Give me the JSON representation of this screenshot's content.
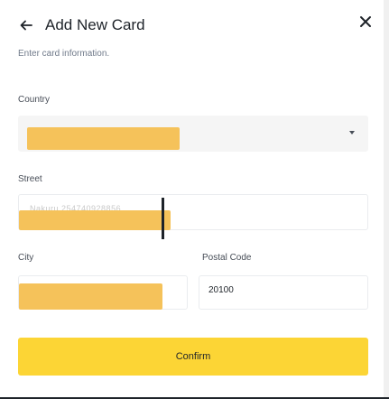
{
  "header": {
    "title": "Add New Card",
    "subtitle": "Enter card information."
  },
  "icons": {
    "back": "arrow-left-icon",
    "close": "close-icon",
    "dropdown": "chevron-down-icon"
  },
  "form": {
    "country": {
      "label": "Country",
      "value": ""
    },
    "street": {
      "label": "Street",
      "value": "Nakuru 254740928856"
    },
    "city": {
      "label": "City",
      "value": ""
    },
    "postal_code": {
      "label": "Postal Code",
      "value": "20100"
    }
  },
  "actions": {
    "confirm_label": "Confirm"
  },
  "colors": {
    "accent": "#fcd535",
    "redaction": "#f5c25a",
    "text": "#1e2329",
    "muted": "#707a8a"
  }
}
